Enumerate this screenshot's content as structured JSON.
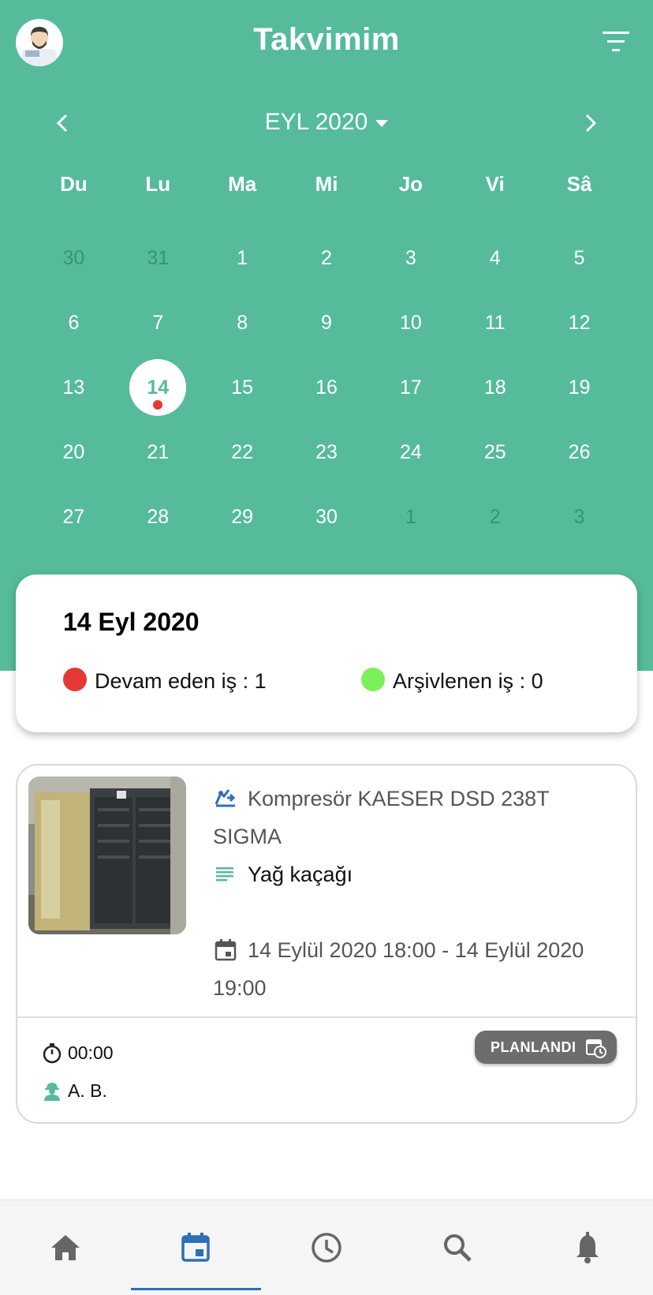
{
  "header": {
    "title": "Takvimim"
  },
  "calendar": {
    "month_label": "EYL 2020",
    "weekdays": [
      "Du",
      "Lu",
      "Ma",
      "Mi",
      "Jo",
      "Vi",
      "Sâ"
    ],
    "weeks": [
      [
        "30",
        "31",
        "1",
        "2",
        "3",
        "4",
        "5"
      ],
      [
        "6",
        "7",
        "8",
        "9",
        "10",
        "11",
        "12"
      ],
      [
        "13",
        "14",
        "15",
        "16",
        "17",
        "18",
        "19"
      ],
      [
        "20",
        "21",
        "22",
        "23",
        "24",
        "25",
        "26"
      ],
      [
        "27",
        "28",
        "29",
        "30",
        "1",
        "2",
        "3"
      ]
    ],
    "selected_day": "14"
  },
  "summary": {
    "date": "14 Eyl 2020",
    "ongoing_label": "Devam eden iş : 1",
    "archived_label": "Arşivlenen iş : 0",
    "ongoing_color": "#e53935",
    "archived_color": "#7cf05a"
  },
  "job": {
    "title": "Kompresör KAESER DSD 238T SIGMA",
    "description": "Yağ kaçağı",
    "datetime": "14 Eylül 2020 18:00 - 14 Eylül 2020 19:00",
    "duration": "00:00",
    "assignee": "A. B.",
    "status": "PLANLANDI"
  },
  "bottom_nav": {
    "items": [
      "home-icon",
      "calendar-icon",
      "clock-icon",
      "search-icon",
      "bell-icon"
    ],
    "active": "calendar-icon"
  },
  "colors": {
    "accent": "#55bb9b",
    "nav_active": "#2d6fb8"
  }
}
